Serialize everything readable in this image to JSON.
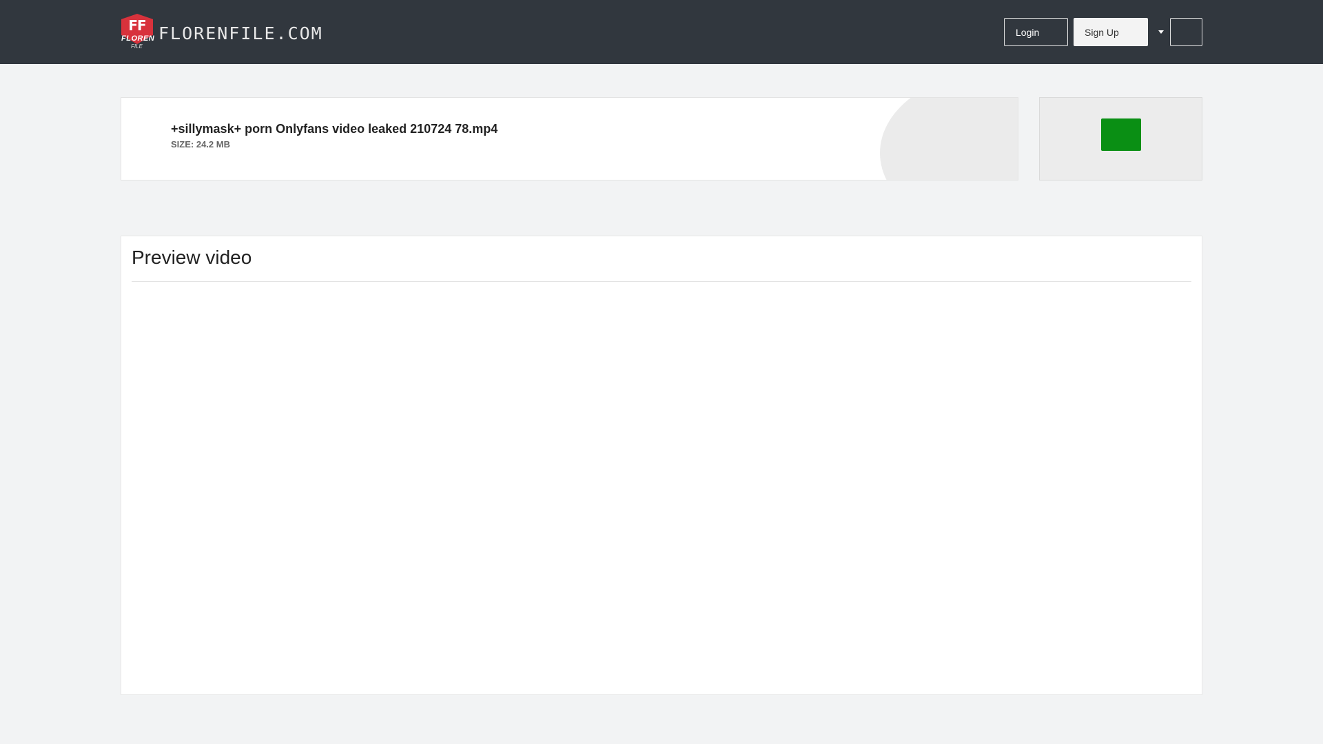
{
  "header": {
    "logo_mark_text": "FF",
    "logo_mark_sub": "FLOREN",
    "logo_mark_sub2": "FILE",
    "site_name": "FLORENFILE.COM",
    "login_label": "Login",
    "signup_label": "Sign Up"
  },
  "file": {
    "name": "+sillymask+ porn Onlyfans video leaked 210724 78.mp4",
    "size": "SIZE: 24.2 MB"
  },
  "preview": {
    "title": "Preview video"
  },
  "colors": {
    "header_bg": "#31373e",
    "page_bg": "#f2f3f4",
    "download_green": "#0a8f14",
    "logo_red": "#d8323c"
  }
}
